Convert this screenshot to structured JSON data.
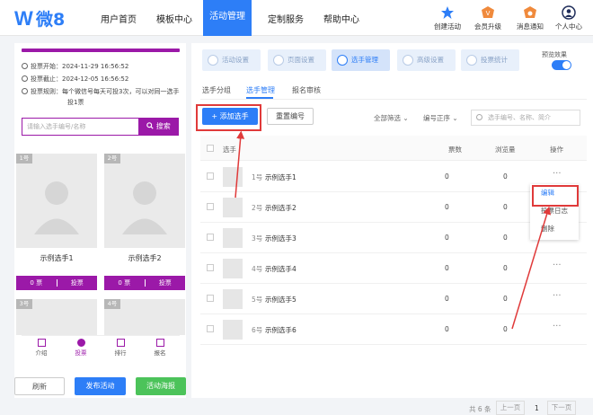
{
  "topnav": {
    "logo_text": "微8",
    "items": [
      "用户首页",
      "模板中心",
      "活动管理",
      "定制服务",
      "帮助中心"
    ],
    "icons": [
      {
        "label": "创建活动",
        "icon": "star-icon"
      },
      {
        "label": "会员升级",
        "icon": "crown-icon"
      },
      {
        "label": "消息通知",
        "icon": "bell-icon"
      },
      {
        "label": "个人中心",
        "icon": "user-icon"
      }
    ]
  },
  "preview": {
    "vote_start": "投票开始：2024-11-29 16:56:52",
    "vote_end": "投票截止：2024-12-05 16:56:52",
    "rule_line1": "投票规则：每个微信号每天可投3次，可以对同一选手",
    "rule_line2": "投1票",
    "search_placeholder": "请输入选手编号/名称",
    "search_button": "搜索",
    "cards": [
      {
        "badge": "1号",
        "name": "示例选手1",
        "votes": "0 票",
        "action": "投票"
      },
      {
        "badge": "2号",
        "name": "示例选手2",
        "votes": "0 票",
        "action": "投票"
      },
      {
        "badge": "3号"
      },
      {
        "badge": "4号"
      }
    ],
    "bottom_tabs": [
      "介绍",
      "投票",
      "排行",
      "报名"
    ],
    "buttons": {
      "refresh": "刷新",
      "publish": "发布活动",
      "poster": "活动海报"
    }
  },
  "steps": [
    "活动设置",
    "页面设置",
    "选手管理",
    "高级设置",
    "投票统计"
  ],
  "preview_toggle_label": "预览效果",
  "subtabs": [
    "选手分组",
    "选手管理",
    "报名审核"
  ],
  "toolbar": {
    "add_button": "+ 添加选手",
    "reorder_button": "重置编号",
    "filter_all": "全部筛选",
    "sort": "编号正序",
    "search_placeholder": "选手编号、名称、简介"
  },
  "table": {
    "headers": [
      "选手",
      "票数",
      "浏览量",
      "操作"
    ],
    "rows": [
      {
        "num": "1号",
        "name": "示例选手1",
        "votes": "0",
        "views": "0"
      },
      {
        "num": "2号",
        "name": "示例选手2",
        "votes": "0",
        "views": "0"
      },
      {
        "num": "3号",
        "name": "示例选手3",
        "votes": "0",
        "views": "0"
      },
      {
        "num": "4号",
        "name": "示例选手4",
        "votes": "0",
        "views": "0"
      },
      {
        "num": "5号",
        "name": "示例选手5",
        "votes": "0",
        "views": "0"
      },
      {
        "num": "6号",
        "name": "示例选手6",
        "votes": "0",
        "views": "0"
      }
    ],
    "more": "···"
  },
  "menu": {
    "edit": "编辑",
    "log": "投票日志",
    "delete": "删除"
  },
  "pagination": {
    "total": "共 6 条",
    "prev": "上一页",
    "page": "1",
    "next": "下一页"
  },
  "colors": {
    "primary": "#2d7ef7",
    "purple": "#9b19a8",
    "green": "#4cc35a",
    "red": "#e03a3a"
  }
}
